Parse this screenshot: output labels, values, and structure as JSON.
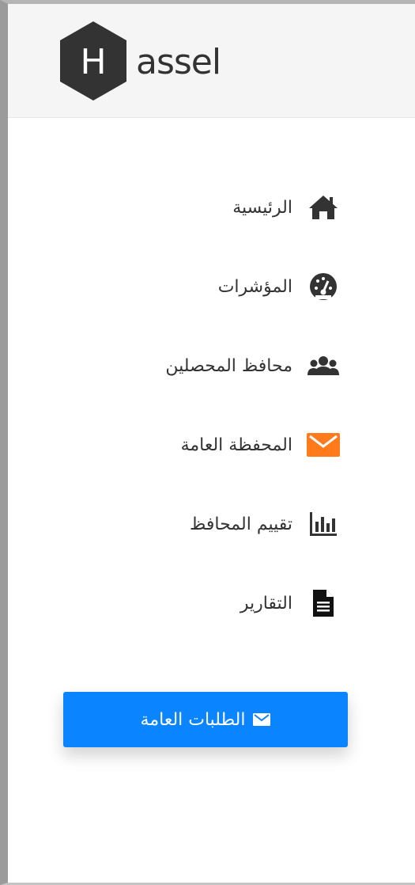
{
  "header": {
    "logo_letter": "H",
    "logo_text": "assel"
  },
  "nav": {
    "items": [
      {
        "label": "الرئيسية",
        "icon": "home-icon"
      },
      {
        "label": "المؤشرات",
        "icon": "dashboard-gauge-icon"
      },
      {
        "label": "محافظ المحصلين",
        "icon": "users-group-icon"
      },
      {
        "label": "المحفظة العامة",
        "icon": "envelope-icon"
      },
      {
        "label": "تقييم المحافظ",
        "icon": "bar-chart-icon"
      },
      {
        "label": "التقارير",
        "icon": "document-icon"
      }
    ],
    "active_index": 3
  },
  "actions": {
    "general_requests_label": "الطلبات العامة",
    "general_requests_icon": "envelope-icon"
  },
  "colors": {
    "accent_orange": "#ff7a1a",
    "primary_blue": "#0a84ff",
    "text_dark": "#333333",
    "header_bg": "#f5f5f5"
  }
}
